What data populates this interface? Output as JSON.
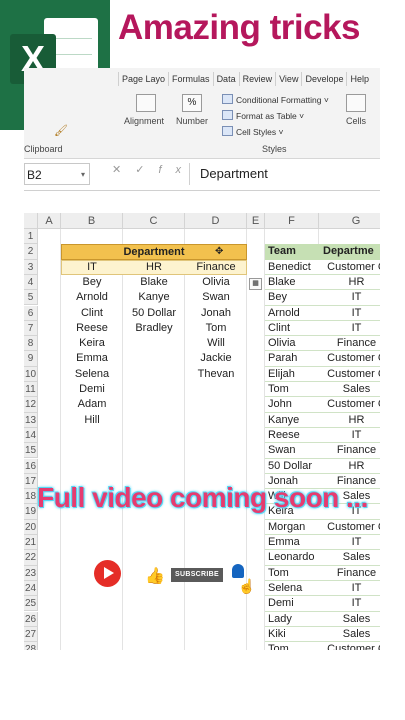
{
  "banner": {
    "title": "Amazing tricks",
    "logo_letter": "X"
  },
  "ribbon": {
    "tabs": [
      "Page Layo",
      "Formulas",
      "Data",
      "Review",
      "View",
      "Develope",
      "Help"
    ],
    "clipboard_label": "Clipboard",
    "alignment_label": "Alignment",
    "number_label": "Number",
    "percent_symbol": "%",
    "conditional_formatting": "Conditional Formatting",
    "format_as_table": "Format as Table",
    "cell_styles": "Cell Styles",
    "styles_label": "Styles",
    "cells_label": "Cells"
  },
  "formula_bar": {
    "name_box": "B2",
    "cancel": "✕",
    "enter": "✓",
    "fx": "fx",
    "content": "Department"
  },
  "columns": [
    "A",
    "B",
    "C",
    "D",
    "E",
    "F",
    "G"
  ],
  "rows": [
    "1",
    "2",
    "3",
    "4",
    "5",
    "6",
    "7",
    "8",
    "9",
    "10",
    "11",
    "12",
    "13",
    "14",
    "15",
    "16",
    "17",
    "18",
    "19",
    "20",
    "21",
    "22",
    "23",
    "24",
    "25",
    "26",
    "27",
    "28"
  ],
  "left_table": {
    "header": "Department",
    "subheaders": [
      "IT",
      "HR",
      "Finance"
    ],
    "it": [
      "Bey",
      "Arnold",
      "Clint",
      "Reese",
      "Keira",
      "Emma",
      "Selena",
      "Demi",
      "Adam",
      "Hill"
    ],
    "hr": [
      "Blake",
      "Kanye",
      "50 Dollar",
      "Bradley"
    ],
    "finance": [
      "Olivia",
      "Swan",
      "Jonah",
      "Tom",
      "Will",
      "Jackie",
      "Thevan"
    ]
  },
  "right_table": {
    "headers": [
      "Team",
      "Departme"
    ],
    "rows": [
      [
        "Benedict",
        "Customer C"
      ],
      [
        "Blake",
        "HR"
      ],
      [
        "Bey",
        "IT"
      ],
      [
        "Arnold",
        "IT"
      ],
      [
        "Clint",
        "IT"
      ],
      [
        "Olivia",
        "Finance"
      ],
      [
        "Parah",
        "Customer C"
      ],
      [
        "Elijah",
        "Customer C"
      ],
      [
        "Tom",
        "Sales"
      ],
      [
        "John",
        "Customer C"
      ],
      [
        "Kanye",
        "HR"
      ],
      [
        "Reese",
        "IT"
      ],
      [
        "Swan",
        "Finance"
      ],
      [
        "50 Dollar",
        "HR"
      ],
      [
        "Jonah",
        "Finance"
      ],
      [
        "Will",
        "Sales"
      ],
      [
        "Keira",
        "IT"
      ],
      [
        "Morgan",
        "Customer C"
      ],
      [
        "Emma",
        "IT"
      ],
      [
        "Leonardo",
        "Sales"
      ],
      [
        "Tom",
        "Finance"
      ],
      [
        "Selena",
        "IT"
      ],
      [
        "Demi",
        "IT"
      ],
      [
        "Lady",
        "Sales"
      ],
      [
        "Kiki",
        "Sales"
      ],
      [
        "Tom",
        "Customer C"
      ]
    ]
  },
  "overlay": {
    "text": "Full video coming soon ...",
    "subscribe": "SUBSCRIBE"
  },
  "icons": [
    "excel-logo-icon",
    "cancel-icon",
    "enter-icon",
    "fx-icon",
    "youtube-play-icon",
    "like-icon",
    "bell-icon",
    "hand-cursor-icon",
    "fill-handle-icon",
    "paste-options-icon"
  ],
  "colors": {
    "title": "#b5175c",
    "excel_green": "#1e7145",
    "header_fill": "#f2c14e",
    "table_header_green": "#c6e0b4",
    "overlay_text": "#e63b6f"
  }
}
